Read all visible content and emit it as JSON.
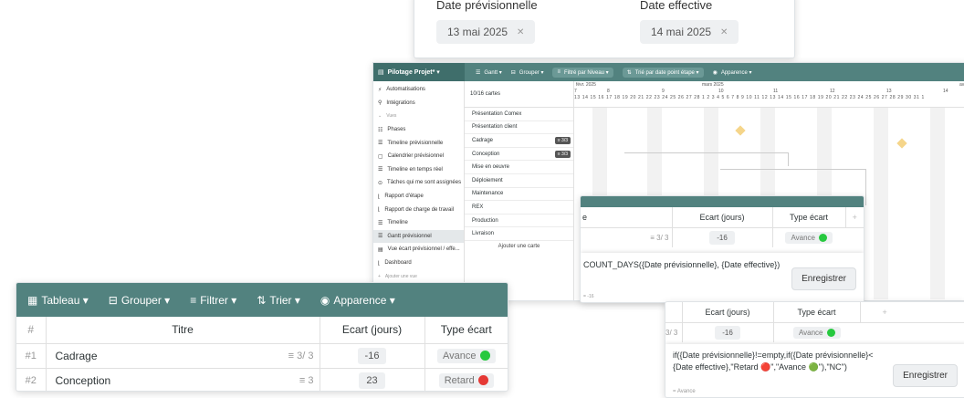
{
  "date_card": {
    "planned_label": "Date prévisionnelle",
    "planned_value": "13 mai 2025",
    "actual_label": "Date effective",
    "actual_value": "14 mai 2025"
  },
  "app": {
    "title": "Pilotage Projet* ▾",
    "toolbar": {
      "gantt": "Gantt ▾",
      "group": "Grouper ▾",
      "filter": "Filtré par Niveau ▾",
      "sort": "Trié par date point étape ▾",
      "appearance": "Apparence ▾"
    },
    "sidebar": {
      "items": [
        {
          "label": "Automatisations",
          "icon": "bolt-icon"
        },
        {
          "label": "Intégrations",
          "icon": "plug-icon"
        },
        {
          "label": "Vues",
          "icon": "chevron-icon"
        },
        {
          "label": "Phases",
          "icon": "list-icon"
        },
        {
          "label": "Timeline prévisionnelle",
          "icon": "timeline-icon"
        },
        {
          "label": "Calendrier prévisionnel",
          "icon": "calendar-icon"
        },
        {
          "label": "Timeline en temps réel",
          "icon": "timeline-icon"
        },
        {
          "label": "Tâches qui me sont assignées",
          "icon": "user-icon"
        },
        {
          "label": "Rapport d'étape",
          "icon": "chart-icon"
        },
        {
          "label": "Rapport de charge de travail",
          "icon": "chart-icon"
        },
        {
          "label": "Timeline",
          "icon": "timeline-icon"
        },
        {
          "label": "Gantt prévisionnel",
          "icon": "timeline-icon"
        },
        {
          "label": "Vue écart prévisionnel / effe...",
          "icon": "table-icon"
        },
        {
          "label": "Dashboard",
          "icon": "chart-icon"
        },
        {
          "label": "Ajouter une vue",
          "icon": "plus-icon"
        }
      ]
    },
    "gantt": {
      "count": "10/16 cartes",
      "add_card": "Ajouter une carte",
      "tasks": [
        {
          "name": "Présentation Comex",
          "tag": ""
        },
        {
          "name": "Présentation client",
          "tag": ""
        },
        {
          "name": "Cadrage",
          "tag": "≡ 3/3"
        },
        {
          "name": "Conception",
          "tag": "≡ 3/3"
        },
        {
          "name": "Mise en oeuvre",
          "tag": ""
        },
        {
          "name": "Déploiement",
          "tag": ""
        },
        {
          "name": "Maintenance",
          "tag": ""
        },
        {
          "name": "REX",
          "tag": ""
        },
        {
          "name": "Production",
          "tag": ""
        },
        {
          "name": "Livraison",
          "tag": ""
        }
      ],
      "months": [
        "févr. 2025",
        "mars 2025",
        "avr"
      ],
      "weeks": [
        "7",
        "8",
        "9",
        "10",
        "11",
        "12",
        "13",
        "14"
      ],
      "days": "13 14 15 16 17 18 19 20 21 22 23 24 25 26 27 28 1 2 3 4 5 6 7 8 9 10 11 12 13 14 15 16 17 18 19 20 21 22 23 24 25 26 27 28 29 30 31 1"
    }
  },
  "formula1": {
    "col_left": "e",
    "col_ecart": "Ecart (jours)",
    "col_type": "Type écart",
    "add": "+",
    "sub": "≡ 3/ 3",
    "value": "-16",
    "type": "Avance",
    "formula": "COUNT_DAYS({Date prévisionnelle}, {Date effective})",
    "save": "Enregistrer",
    "preview": "= -16"
  },
  "formula2": {
    "col_ecart": "Ecart (jours)",
    "col_type": "Type écart",
    "add": "+",
    "sub": "3/ 3",
    "value": "-16",
    "type": "Avance",
    "formula": "if({Date prévisionnelle}!=empty,if({Date prévisionnelle}< {Date effective},\"Retard 🔴\",\"Avance 🟢\"),\"NC\")",
    "save": "Enregistrer",
    "preview": "= Avance"
  },
  "table": {
    "toolbar": {
      "view": "Tableau ▾",
      "group": "Grouper ▾",
      "filter": "Filtrer ▾",
      "sort": "Trier ▾",
      "appearance": "Apparence ▾"
    },
    "headers": {
      "num": "#",
      "title": "Titre",
      "ecart": "Ecart (jours)",
      "type": "Type écart"
    },
    "rows": [
      {
        "num": "#1",
        "title": "Cadrage",
        "sub": "≡ 3/ 3",
        "ecart": "-16",
        "type": "Avance",
        "color": "#27c93f"
      },
      {
        "num": "#2",
        "title": "Conception",
        "sub": "≡ 3",
        "ecart": "23",
        "type": "Retard",
        "color": "#e53935"
      }
    ]
  }
}
